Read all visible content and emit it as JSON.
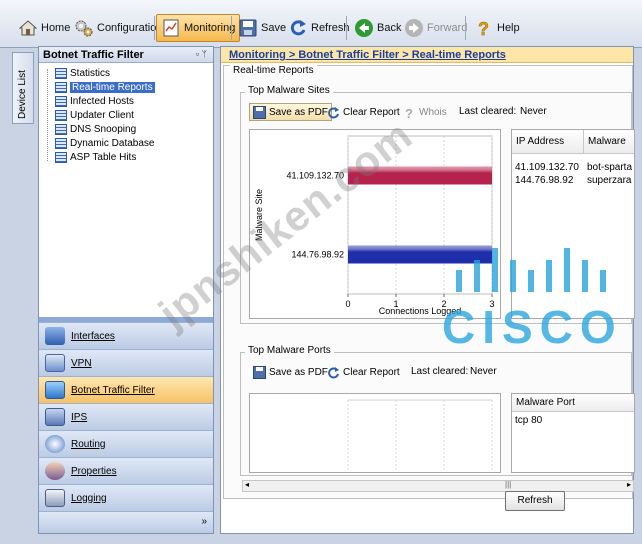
{
  "toolbar": {
    "items": [
      {
        "label": "Home",
        "icon": "home-icon"
      },
      {
        "label": "Configuration",
        "icon": "gears-icon"
      },
      {
        "label": "Monitoring",
        "icon": "monitor-icon",
        "active": true
      },
      {
        "label": "Save",
        "icon": "floppy-icon"
      },
      {
        "label": "Refresh",
        "icon": "refresh-icon"
      },
      {
        "label": "Back",
        "icon": "back-arrow-icon"
      },
      {
        "label": "Forward",
        "icon": "forward-arrow-icon",
        "disabled": true
      },
      {
        "label": "Help",
        "icon": "help-icon"
      }
    ]
  },
  "device_list": {
    "label": "Device List"
  },
  "nav": {
    "title": "Botnet Traffic Filter",
    "tree": [
      "Statistics",
      "Real-time Reports",
      "Infected Hosts",
      "Updater Client",
      "DNS Snooping",
      "Dynamic Database",
      "ASP Table Hits"
    ],
    "selected": "Real-time Reports",
    "sections": [
      {
        "label": "Interfaces",
        "icon": "interfaces-icon"
      },
      {
        "label": "VPN",
        "icon": "vpn-icon"
      },
      {
        "label": "Botnet Traffic Filter",
        "icon": "botnet-icon",
        "active": true
      },
      {
        "label": "IPS",
        "icon": "ips-icon"
      },
      {
        "label": "Routing",
        "icon": "routing-icon"
      },
      {
        "label": "Properties",
        "icon": "properties-icon"
      },
      {
        "label": "Logging",
        "icon": "logging-icon"
      }
    ],
    "more": "»"
  },
  "main": {
    "breadcrumb": "Monitoring > Botnet Traffic Filter > Real-time Reports",
    "group_title": "Real-time Reports",
    "sites": {
      "title": "Top Malware Sites",
      "save_pdf": "Save as PDF",
      "clear_report": "Clear Report",
      "whois": "Whois",
      "last_cleared_label": "Last cleared:",
      "last_cleared_value": "Never",
      "table_headers": [
        "IP Address",
        "Malware"
      ],
      "table_rows": [
        [
          "41.109.132.70",
          "bot-sparta"
        ],
        [
          "144.76.98.92",
          "superzara"
        ]
      ]
    },
    "ports": {
      "title": "Top Malware Ports",
      "save_pdf": "Save as PDF",
      "clear_report": "Clear Report",
      "last_cleared_label": "Last cleared:",
      "last_cleared_value": "Never",
      "table_headers": [
        "Malware Port"
      ],
      "table_rows": [
        [
          "tcp 80"
        ]
      ]
    },
    "refresh": "Refresh"
  },
  "watermarks": {
    "text": "jpnshiken.com",
    "logo": "CISCO"
  },
  "colors": {
    "bar_1": "#b5234d",
    "bar_2": "#1f2ea9",
    "breadcrumb_bg": "#fde6a8",
    "active_tab": "#f5b94d",
    "cisco": "#27a4dd"
  },
  "chart_data": {
    "type": "bar",
    "orientation": "horizontal",
    "categories": [
      "41.109.132.70",
      "144.76.98.92"
    ],
    "values": [
      3,
      3
    ],
    "xlabel": "Connections Logged",
    "ylabel": "Malware Site",
    "xlim": [
      0,
      3
    ],
    "xticks": [
      0,
      1,
      2,
      3
    ],
    "grid": true
  }
}
